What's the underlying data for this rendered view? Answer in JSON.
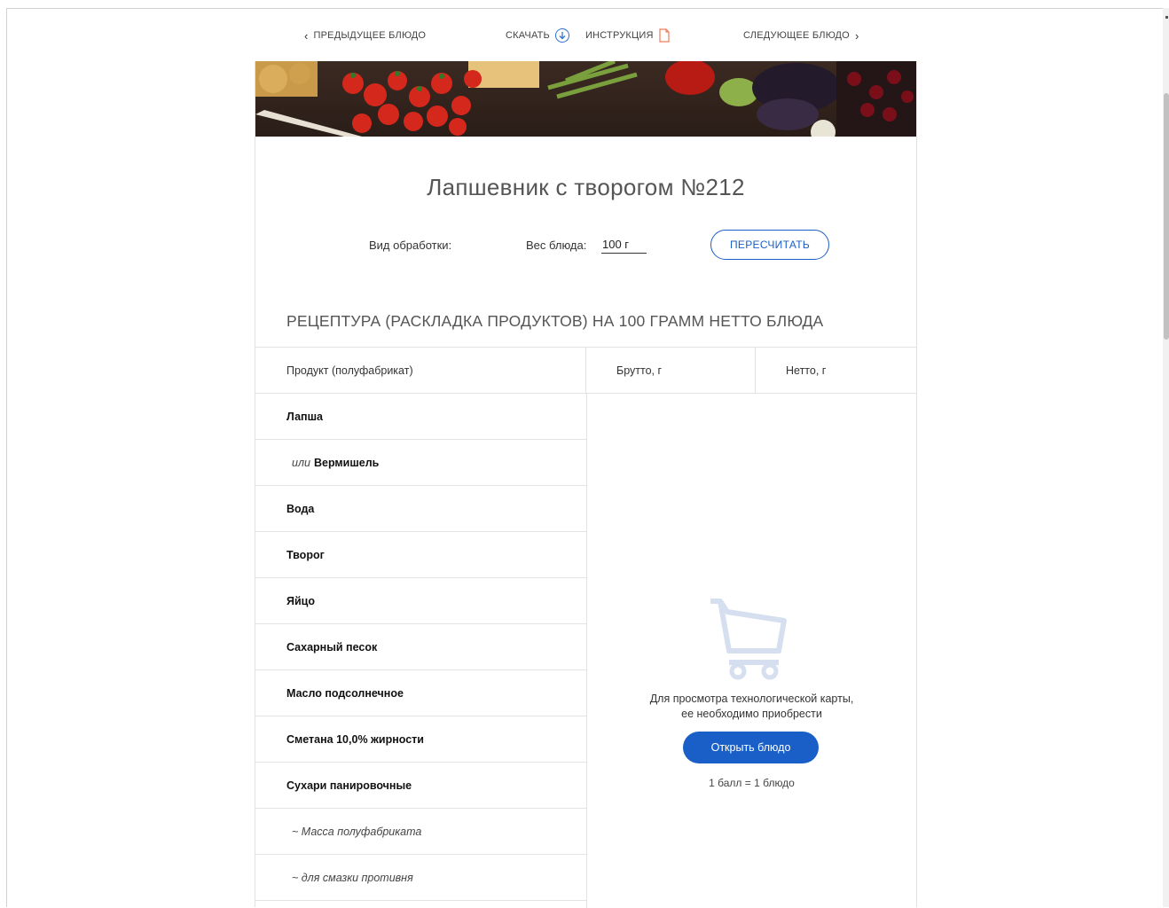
{
  "nav": {
    "prev_label": "ПРЕДЫДУЩЕЕ БЛЮДО",
    "download_label": "СКАЧАТЬ",
    "instruction_label": "ИНСТРУКЦИЯ",
    "next_label": "СЛЕДУЮЩЕЕ БЛЮДО"
  },
  "dish": {
    "title": "Лапшевник с творогом №212"
  },
  "controls": {
    "processing_label": "Вид обработки:",
    "weight_label": "Вес блюда:",
    "weight_value": "100 г",
    "recalc_label": "ПЕРЕСЧИТАТЬ"
  },
  "recipe": {
    "section_title": "РЕЦЕПТУРА (РАСКЛАДКА ПРОДУКТОВ) НА 100 ГРАММ НЕТТО БЛЮДА",
    "headers": {
      "product": "Продукт (полуфабрикат)",
      "brutto": "Брутто, г",
      "netto": "Нетто, г"
    },
    "rows": [
      {
        "name": "Лапша"
      },
      {
        "prefix": "или",
        "name": "Вермишель"
      },
      {
        "name": "Вода"
      },
      {
        "name": "Творог"
      },
      {
        "name": "Яйцо"
      },
      {
        "name": "Сахарный песок"
      },
      {
        "name": "Масло подсолнечное"
      },
      {
        "name": "Сметана 10,0% жирности"
      },
      {
        "name": "Сухари панировочные"
      },
      {
        "note": "~ Масса полуфабриката"
      },
      {
        "note": "~ для смазки противня"
      }
    ]
  },
  "paywall": {
    "line1": "Для просмотра технологической карты,",
    "line2": "ее необходимо приобрести",
    "button_label": "Открыть блюдо",
    "price_text": "1 балл = 1 блюдо"
  },
  "colors": {
    "accent": "#1a5fc7",
    "doc_icon": "#f07b5a",
    "cart_icon": "#d6dff0"
  },
  "icons": {
    "prev": "chevron-left-icon",
    "download": "download-circle-icon",
    "instruction": "document-icon",
    "next": "chevron-right-icon",
    "cart": "shopping-cart-icon"
  }
}
